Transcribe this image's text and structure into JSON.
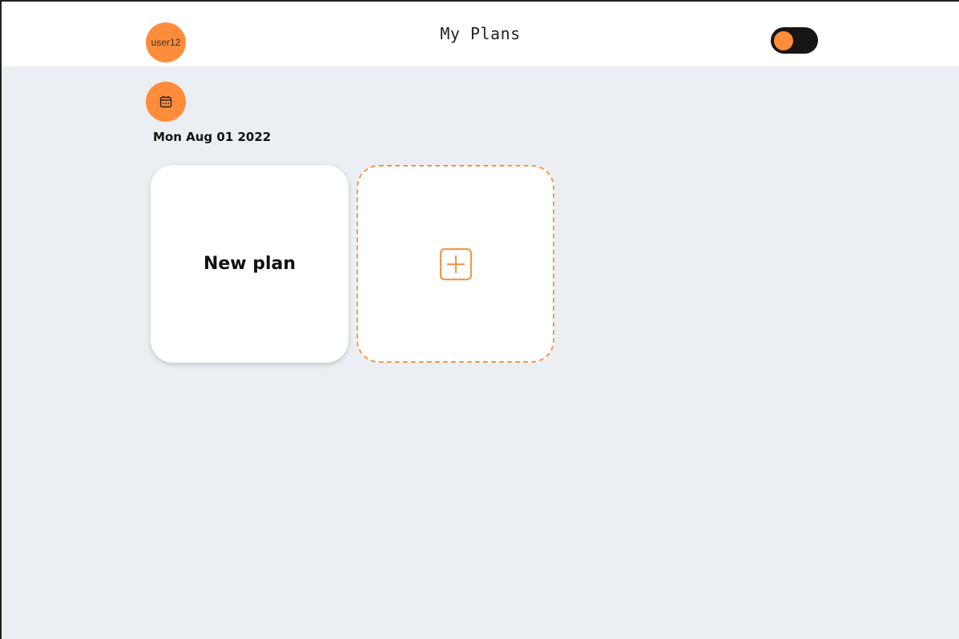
{
  "header": {
    "title": "My Plans",
    "user_label": "user12",
    "theme_toggle": {
      "state": "on"
    }
  },
  "calendar_button": {
    "icon": "calendar-icon"
  },
  "main": {
    "date": "Mon Aug 01 2022",
    "plans": [
      {
        "title": "New plan"
      }
    ],
    "add_plan": {
      "icon": "plus-square-icon"
    }
  },
  "colors": {
    "accent": "#ff8c3a",
    "background": "#ebeef2",
    "card": "#ffffff",
    "toggle_track": "#161616"
  }
}
